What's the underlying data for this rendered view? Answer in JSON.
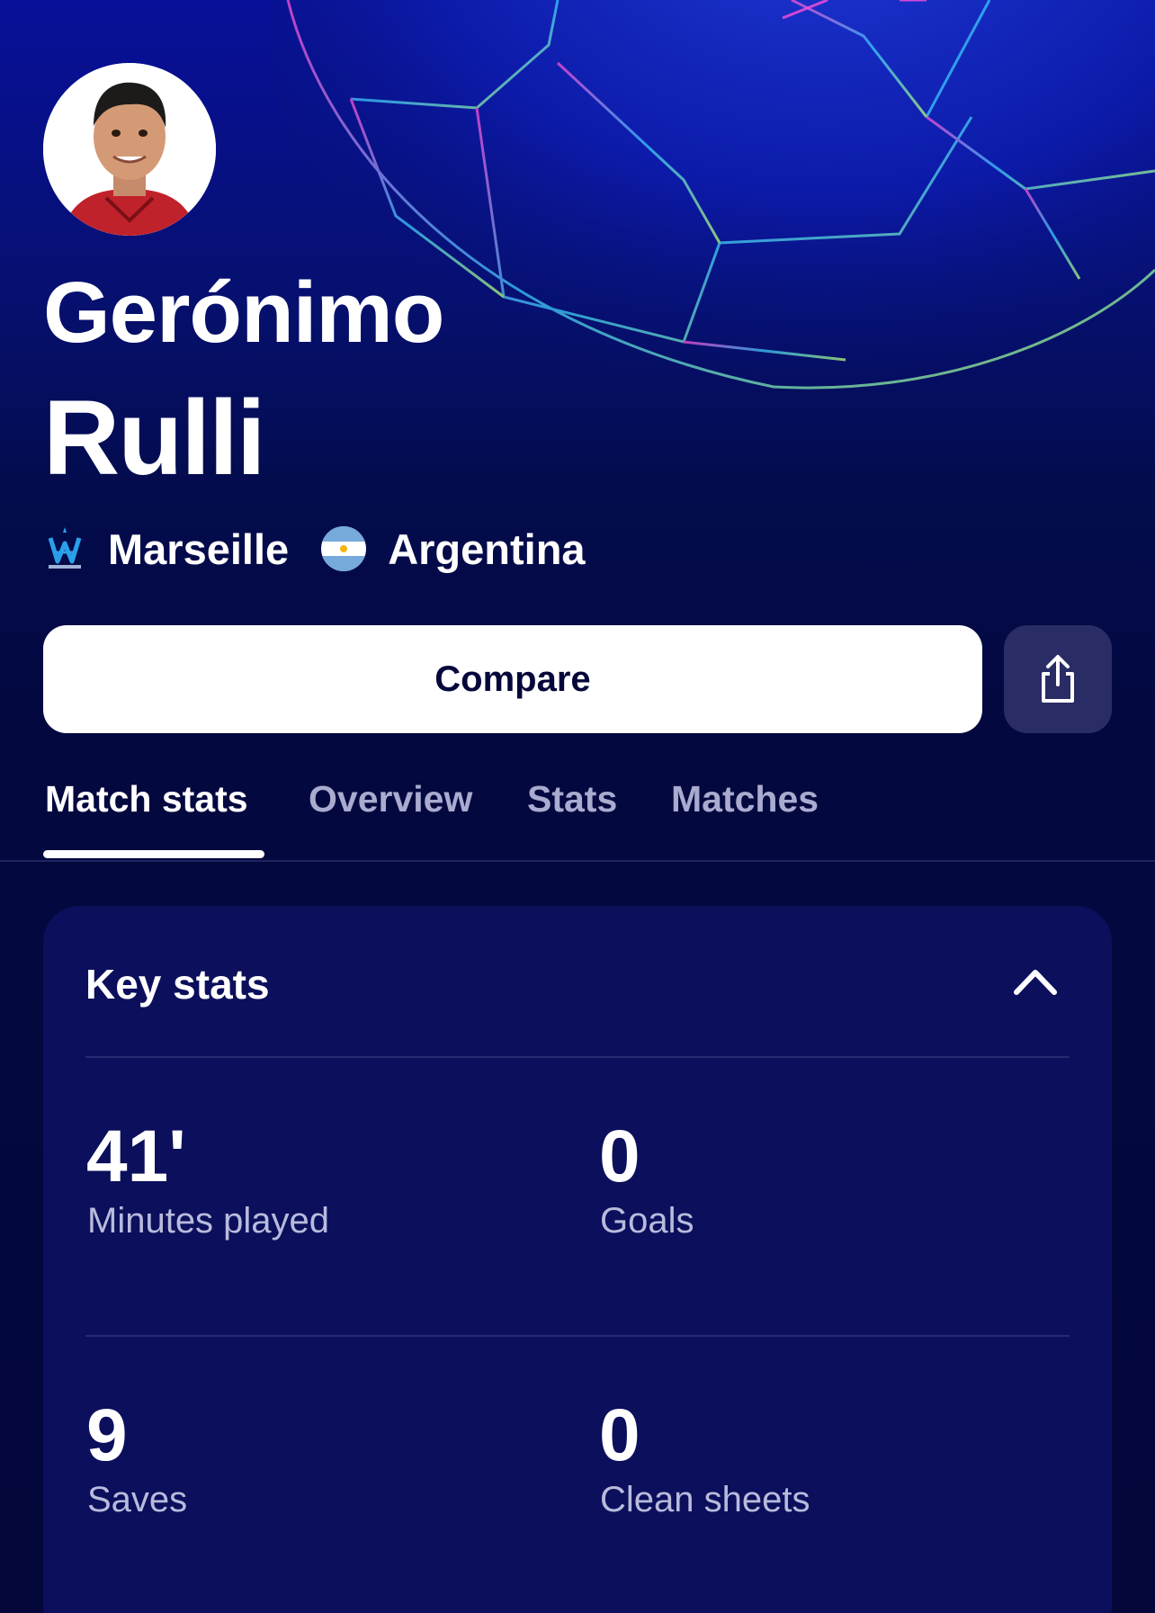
{
  "player": {
    "first_name": "Gerónimo",
    "last_name": "Rulli",
    "club": "Marseille",
    "nation": "Argentina"
  },
  "actions": {
    "compare_label": "Compare",
    "share_icon": "share-icon"
  },
  "tabs": [
    {
      "label": "Match stats",
      "active": true
    },
    {
      "label": "Overview",
      "active": false
    },
    {
      "label": "Stats",
      "active": false
    },
    {
      "label": "Matches",
      "active": false
    }
  ],
  "key_stats": {
    "title": "Key stats",
    "items": [
      {
        "value": "41'",
        "label": "Minutes played"
      },
      {
        "value": "0",
        "label": "Goals"
      },
      {
        "value": "9",
        "label": "Saves"
      },
      {
        "value": "0",
        "label": "Clean sheets"
      }
    ]
  },
  "colors": {
    "background": "#03073a",
    "card": "#0b0f5c",
    "accent_white": "#ffffff",
    "muted_text": "#b9bbdc"
  }
}
